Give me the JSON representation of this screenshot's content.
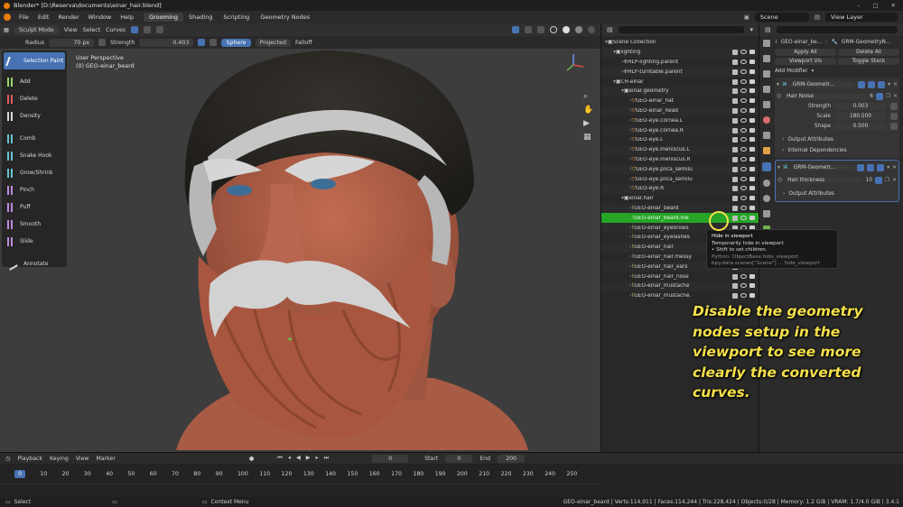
{
  "window": {
    "title": "Blender* [D:\\Reserva\\documents\\einar_hair.blend]",
    "controls": [
      "–",
      "□",
      "✕"
    ]
  },
  "menu": {
    "items": [
      "File",
      "Edit",
      "Render",
      "Window",
      "Help"
    ],
    "workspaces": [
      "Grooming",
      "Shading",
      "Scripting",
      "Geometry Nodes"
    ],
    "active_workspace": "Grooming",
    "scene_label": "Scene",
    "view_layer_label": "View Layer"
  },
  "tool_header": {
    "mode": "Sculpt Mode",
    "menus": [
      "View",
      "Select",
      "Curves"
    ]
  },
  "brush_settings": {
    "radius_label": "Radius",
    "radius_value": "70 px",
    "strength_label": "Strength",
    "strength_value": "0.403",
    "sphere": "Sphere",
    "projected": "Projected",
    "falloff": "Falloff"
  },
  "viewport": {
    "perspective_label": "User Perspective",
    "object_label": "(0) GEO-einar_beard"
  },
  "tools": [
    {
      "label": "Selection Paint",
      "icon": "selection-paint-icon",
      "active": true
    },
    {
      "label": "Add",
      "icon": "add-curve-icon",
      "active": false
    },
    {
      "label": "Delete",
      "icon": "delete-curve-icon",
      "active": false
    },
    {
      "label": "Density",
      "icon": "density-icon",
      "active": false
    },
    {
      "label": "Comb",
      "icon": "comb-icon",
      "active": false
    },
    {
      "label": "Snake Hook",
      "icon": "snake-hook-icon",
      "active": false
    },
    {
      "label": "Grow/Shrink",
      "icon": "grow-shrink-icon",
      "active": false
    },
    {
      "label": "Pinch",
      "icon": "pinch-icon",
      "active": false
    },
    {
      "label": "Puff",
      "icon": "puff-icon",
      "active": false
    },
    {
      "label": "Smooth",
      "icon": "smooth-icon",
      "active": false
    },
    {
      "label": "Slide",
      "icon": "slide-icon",
      "active": false
    },
    {
      "label": "Annotate",
      "icon": "annotate-icon",
      "active": false
    }
  ],
  "outliner": {
    "rows": [
      {
        "label": "Scene Collection",
        "indent": 0,
        "type": "scene"
      },
      {
        "label": "lighting",
        "indent": 1,
        "type": "collection"
      },
      {
        "label": "HLP-lighting.parent",
        "indent": 2,
        "type": "empty"
      },
      {
        "label": "HLP-turntable.parent",
        "indent": 2,
        "type": "empty"
      },
      {
        "label": "CH-einar",
        "indent": 1,
        "type": "collection"
      },
      {
        "label": "einar.geometry",
        "indent": 2,
        "type": "collection"
      },
      {
        "label": "GEO-einar_hat",
        "indent": 3,
        "type": "mesh"
      },
      {
        "label": "GEO-einar_head",
        "indent": 3,
        "type": "mesh"
      },
      {
        "label": "GEO-eye.cornea.L",
        "indent": 3,
        "type": "mesh"
      },
      {
        "label": "GEO-eye.cornea.R",
        "indent": 3,
        "type": "mesh"
      },
      {
        "label": "GEO-eye.L",
        "indent": 3,
        "type": "mesh"
      },
      {
        "label": "GEO-eye.meniscus.L",
        "indent": 3,
        "type": "mesh"
      },
      {
        "label": "GEO-eye.meniscus.R",
        "indent": 3,
        "type": "mesh"
      },
      {
        "label": "GEO-eye.plica_semilu",
        "indent": 3,
        "type": "mesh"
      },
      {
        "label": "GEO-eye.plica_semilu",
        "indent": 3,
        "type": "mesh"
      },
      {
        "label": "GEO-eye.R",
        "indent": 3,
        "type": "mesh"
      },
      {
        "label": "einar.hair",
        "indent": 2,
        "type": "collection"
      },
      {
        "label": "GEO-einar_beard",
        "indent": 3,
        "type": "curves"
      },
      {
        "label": "GEO-einar_beard.me",
        "indent": 3,
        "type": "curves",
        "selected": true
      },
      {
        "label": "GEO-einar_eyebrows",
        "indent": 3,
        "type": "curves"
      },
      {
        "label": "GEO-einar_eyelashes",
        "indent": 3,
        "type": "curves"
      },
      {
        "label": "GEO-einar_hair",
        "indent": 3,
        "type": "curves"
      },
      {
        "label": "GEO-einar_hair.messy",
        "indent": 3,
        "type": "curves"
      },
      {
        "label": "GEO-einar_hair_ears",
        "indent": 3,
        "type": "curves"
      },
      {
        "label": "GEO-einar_hair_nose",
        "indent": 3,
        "type": "curves"
      },
      {
        "label": "GEO-einar_mustache",
        "indent": 3,
        "type": "curves"
      },
      {
        "label": "GEO-einar_mustache.",
        "indent": 3,
        "type": "curves"
      }
    ]
  },
  "tooltip": {
    "title": "Hide in viewport",
    "line1": "Temporarily hide in viewport",
    "line2": "• Shift to set children.",
    "python1": "Python: ObjectBase.hide_viewport",
    "python2": "bpy.data.scenes[\"Scene\"] ... hide_viewport"
  },
  "properties": {
    "object_name": "GEO-einar_be...",
    "modifier_name": "GRM-GeometryN...",
    "apply_all": "Apply All",
    "delete_all": "Delete All",
    "viewport_vis": "Viewport Vis",
    "toggle_stack": "Toggle Stack",
    "add_modifier": "Add Modifier",
    "modifiers": [
      {
        "name": "GRM-Geometr...",
        "nodegroup": "Hair Noise",
        "nodegroup_users": "6",
        "fields": [
          {
            "label": "Strength",
            "value": "0.003"
          },
          {
            "label": "Scale",
            "value": "180.500"
          },
          {
            "label": "Shape",
            "value": "0.500"
          }
        ],
        "sections": [
          "Output Attributes",
          "Internal Dependencies"
        ]
      },
      {
        "name": "GRM-Geometr...",
        "nodegroup": "Hair thickness",
        "nodegroup_users": "10",
        "fields": [],
        "sections": [
          "Output Attributes"
        ]
      }
    ]
  },
  "timeline": {
    "menus": [
      "Playback",
      "Keying",
      "View",
      "Marker"
    ],
    "current_frame": "0",
    "start_label": "Start",
    "start_value": "0",
    "end_label": "End",
    "end_value": "200",
    "frame_ticks": [
      "0",
      "10",
      "20",
      "30",
      "40",
      "50",
      "60",
      "70",
      "80",
      "90",
      "100",
      "110",
      "120",
      "130",
      "140",
      "150",
      "160",
      "170",
      "180",
      "190",
      "200",
      "210",
      "220",
      "230",
      "240",
      "250"
    ]
  },
  "statusbar": {
    "left": "Select",
    "middle": "Context Menu",
    "right": "GEO-einar_beard | Verts:114,911 | Faces:114,244 | Tris:228,424 | Objects:0/28 | Memory: 1.2 GiB | VRAM: 1.7/4.0 GiB | 3.4.1"
  },
  "caption": "Disable the geometry nodes setup in the viewport to see more clearly the converted curves.",
  "colors": {
    "accent": "#4772b3",
    "selection": "#26a526",
    "caption": "#f5e04a",
    "skin": "#b0624a",
    "hair": "#c8c8c8",
    "hat": "#2a2723"
  }
}
